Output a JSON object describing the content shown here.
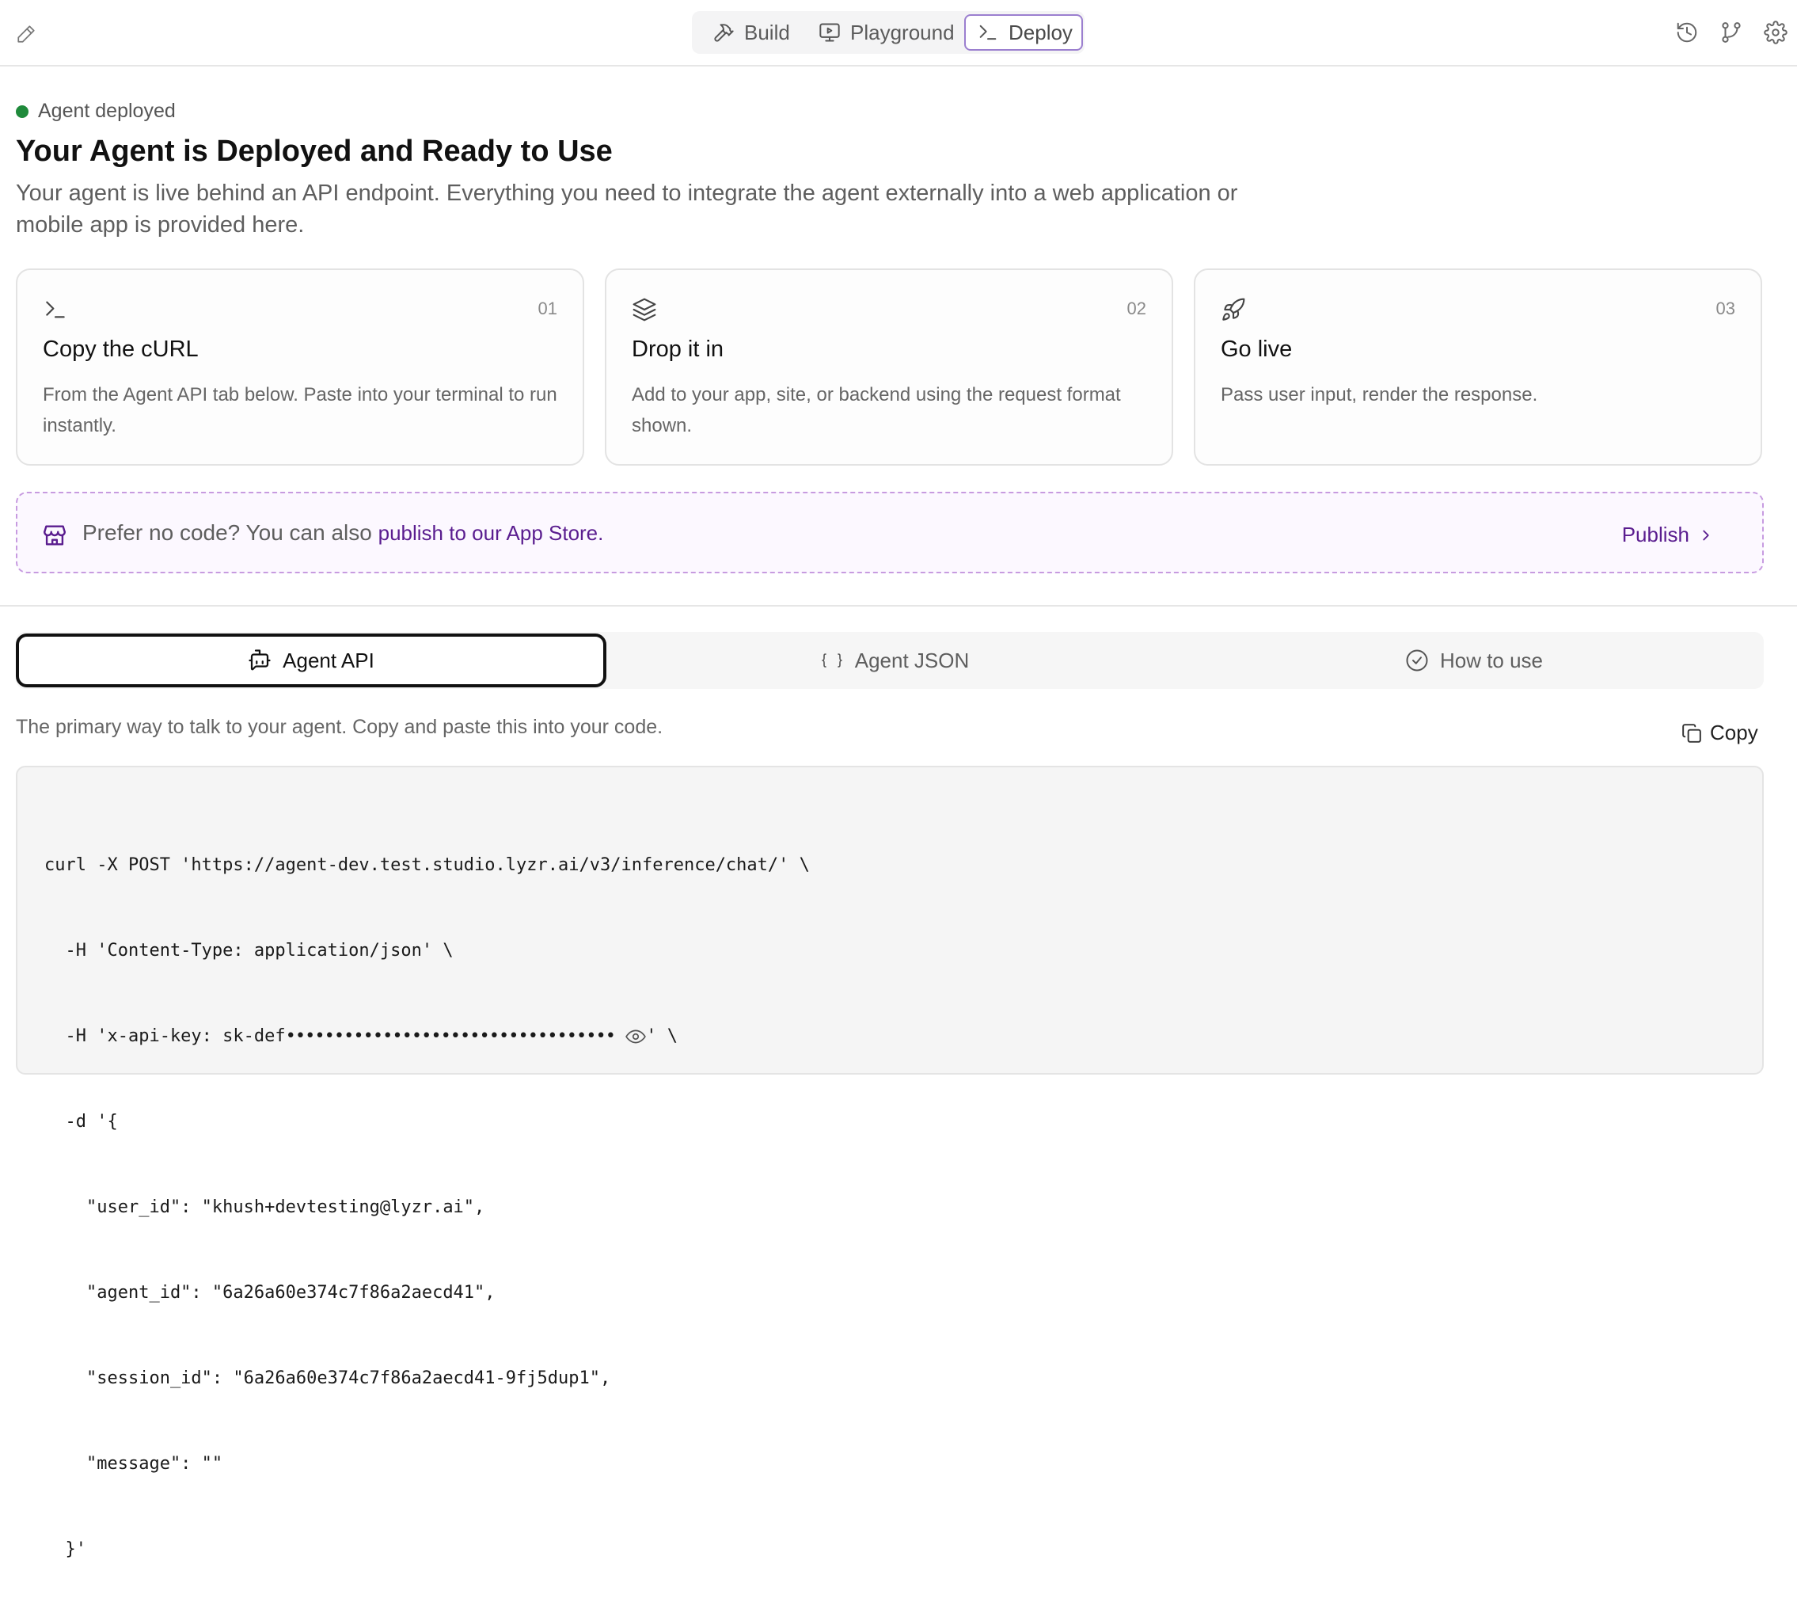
{
  "nav": {
    "tabs": [
      {
        "label": "Build",
        "icon": "hammer-icon"
      },
      {
        "label": "Playground",
        "icon": "monitor-play-icon"
      },
      {
        "label": "Deploy",
        "icon": "terminal-icon"
      }
    ],
    "active_tab": "Deploy",
    "right_icons": [
      "history-icon",
      "git-branch-icon",
      "settings-icon"
    ]
  },
  "status": {
    "text": "Agent deployed",
    "color": "#1f8a3b"
  },
  "header": {
    "title": "Your Agent is Deployed and Ready to Use",
    "description": "Your agent is live behind an API endpoint. Everything you need to integrate the agent externally into a web application or mobile app is provided here."
  },
  "steps": [
    {
      "num": "01",
      "icon": "terminal-icon",
      "title": "Copy the cURL",
      "desc": "From the Agent API tab below. Paste into your terminal to run instantly."
    },
    {
      "num": "02",
      "icon": "layers-icon",
      "title": "Drop it in",
      "desc": "Add to your app, site, or backend using the request format shown."
    },
    {
      "num": "03",
      "icon": "rocket-icon",
      "title": "Go live",
      "desc": "Pass user input, render the response."
    }
  ],
  "banner": {
    "text": "Prefer no code? You can also",
    "link": "publish to our App Store.",
    "action": "Publish",
    "accent": "#5a1d8f"
  },
  "tabs2": [
    {
      "label": "Agent API",
      "icon": "bot-icon"
    },
    {
      "label": "Agent JSON",
      "icon": "braces-icon"
    },
    {
      "label": "How to use",
      "icon": "check-circle-icon"
    }
  ],
  "api": {
    "description": "The primary way to talk to your agent. Copy and paste this into your code.",
    "copy_label": "Copy",
    "code": {
      "l1": "curl -X POST 'https://agent-dev.test.studio.lyzr.ai/v3/inference/chat/' \\",
      "l2": "  -H 'Content-Type: application/json' \\",
      "l3_prefix": "  -H 'x-api-key: sk-def",
      "l3_mask": "••••••••••••••••••••••••••••••••••",
      "l3_suffix": "' \\",
      "l4": "  -d '{",
      "l5": "    \"user_id\": \"khush+devtesting@lyzr.ai\",",
      "l6": "    \"agent_id\": \"6a26a60e374c7f86a2aecd41\",",
      "l7": "    \"session_id\": \"6a26a60e374c7f86a2aecd41-9fj5dup1\",",
      "l8": "    \"message\": \"\"",
      "l9": "  }'"
    }
  }
}
